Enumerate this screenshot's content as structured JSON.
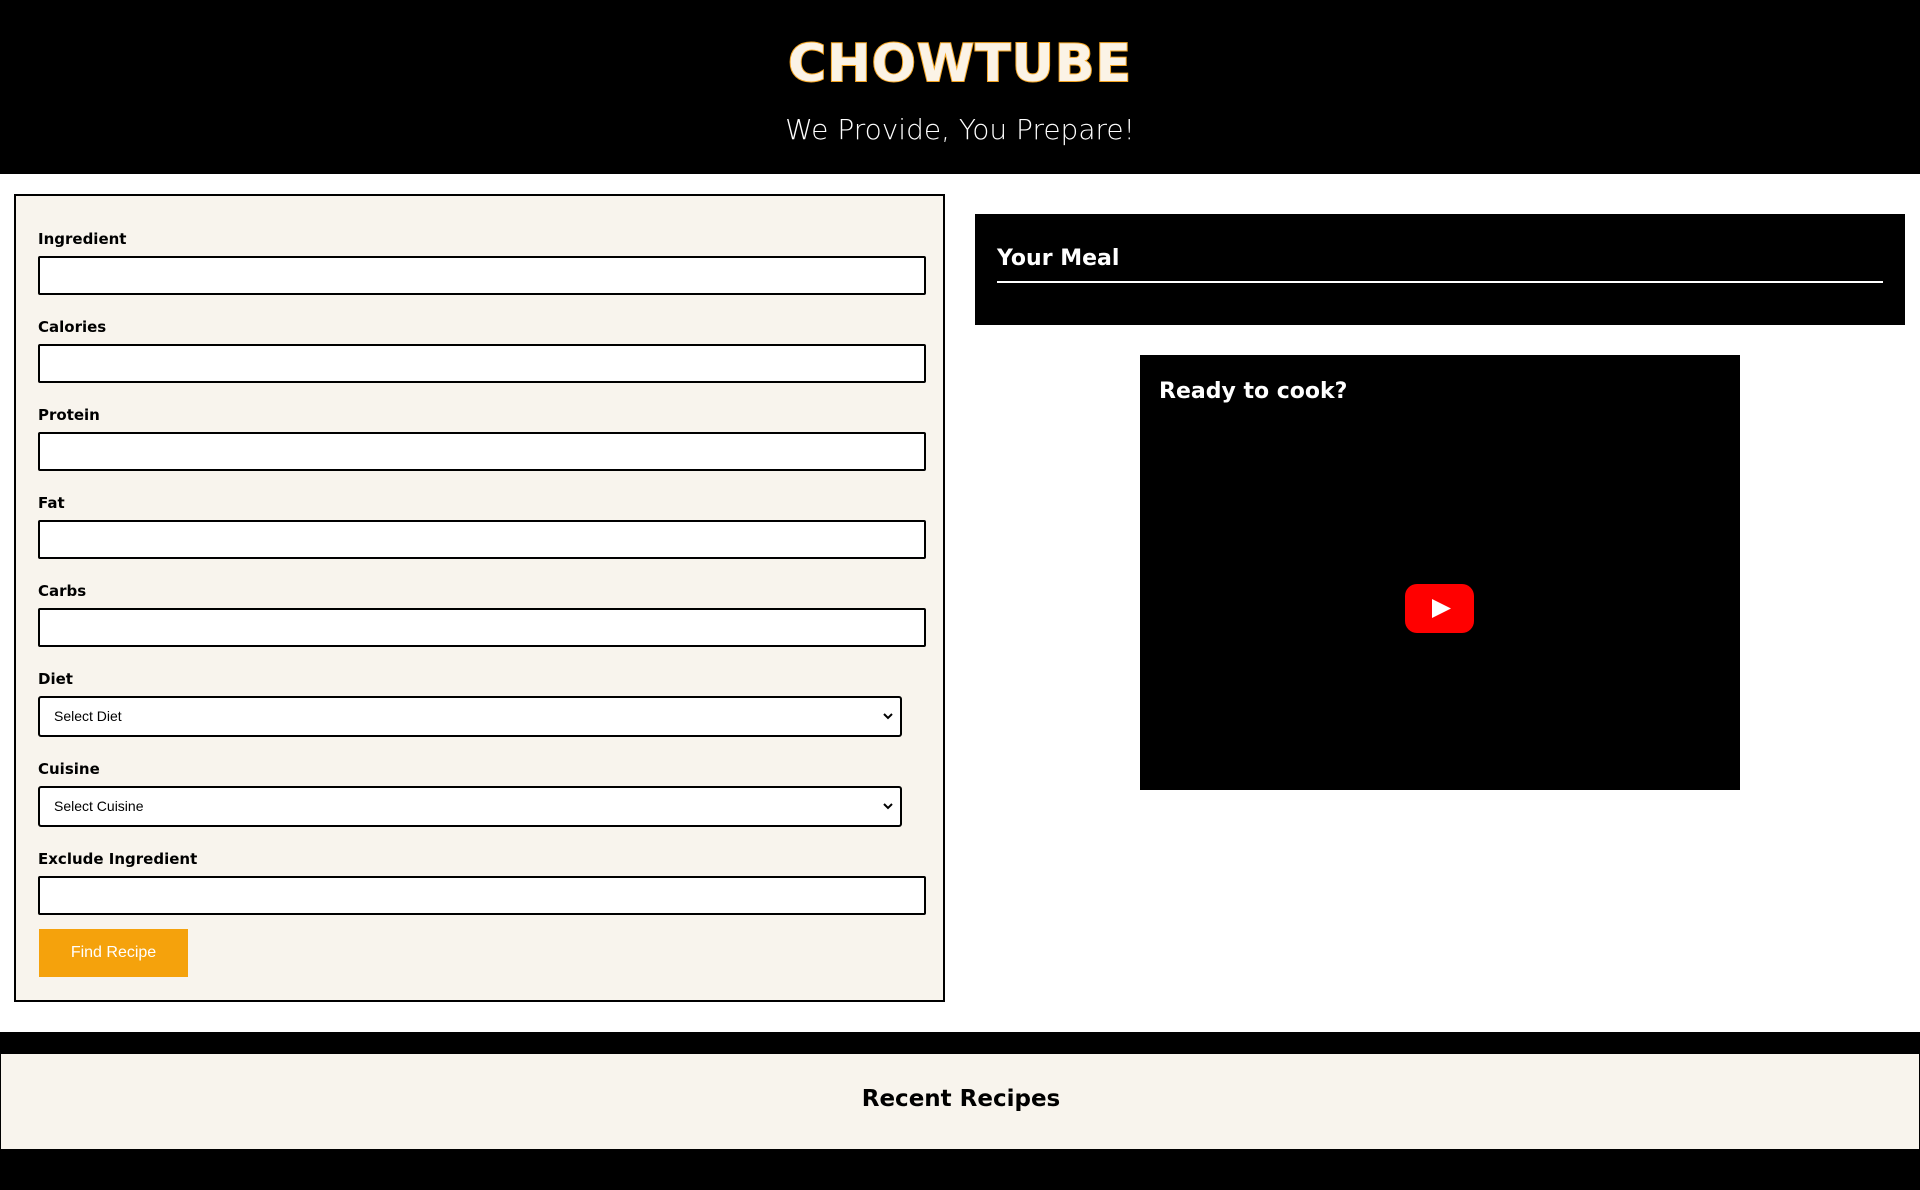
{
  "header": {
    "brand": "CHOWTUBE",
    "tagline": "We Provide, You Prepare!"
  },
  "form": {
    "fields": [
      {
        "label": "Ingredient",
        "value": ""
      },
      {
        "label": "Calories",
        "value": ""
      },
      {
        "label": "Protein",
        "value": ""
      },
      {
        "label": "Fat",
        "value": ""
      },
      {
        "label": "Carbs",
        "value": ""
      }
    ],
    "diet": {
      "label": "Diet",
      "selected": "Select Diet"
    },
    "cuisine": {
      "label": "Cuisine",
      "selected": "Select Cuisine"
    },
    "exclude": {
      "label": "Exclude Ingredient",
      "value": ""
    },
    "submit_label": "Find Recipe"
  },
  "meal": {
    "title": "Your Meal"
  },
  "video": {
    "title": "Ready to cook?",
    "play_icon": "youtube-play-icon"
  },
  "recent": {
    "title": "Recent Recipes"
  },
  "colors": {
    "accent": "#f5a20c",
    "panel_bg": "#f8f4ed",
    "dark": "#000000",
    "play_red": "#ff0000"
  }
}
